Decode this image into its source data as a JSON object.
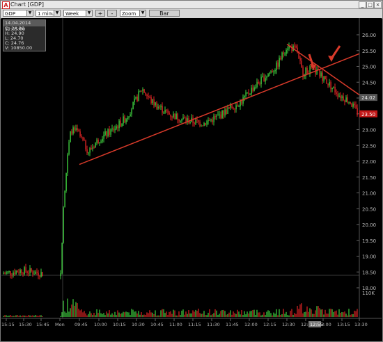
{
  "window": {
    "title": "Chart [GDP]",
    "app_icon": "A",
    "controls": [
      "_",
      "□",
      "×"
    ]
  },
  "toolbar": {
    "symbol": "GDP",
    "interval": "1 minute",
    "range": "Week",
    "plus_label": "+",
    "minus_label": "-",
    "zoom": "Zoom",
    "bar_label": "Bar"
  },
  "info_box": {
    "header": "14.04.2014 12:55:00",
    "open": "O: 24.86",
    "high": "H: 24.90",
    "low": "L: 24.70",
    "close": "C: 24.76",
    "volume": "V: 10850.00"
  },
  "price_axis": {
    "ticks": [
      "26.00",
      "25.50",
      "25.00",
      "24.50",
      "24.00",
      "23.50",
      "23.00",
      "22.50",
      "22.00",
      "21.50",
      "21.00",
      "20.50",
      "20.00",
      "19.50",
      "19.00",
      "18.50",
      "18.00"
    ],
    "current_price_label": "24.02",
    "last_price_label": "23.50",
    "volume_label": "110K"
  },
  "time_axis": {
    "ticks": [
      "15:15",
      "15:30",
      "15:45",
      "Mon",
      "09:45",
      "10:00",
      "10:15",
      "10:30",
      "10:45",
      "11:00",
      "11:15",
      "11:30",
      "11:45",
      "12:00",
      "12:15",
      "12:30",
      "12:45",
      "13:00",
      "13:15",
      "13:30"
    ],
    "cursor_label": "12:55"
  },
  "chart_data": {
    "type": "candlestick",
    "title": "GDP",
    "x_range": [
      "Fri 15:15",
      "Mon 13:30"
    ],
    "ylim": [
      17.8,
      26.3
    ],
    "series_summary": {
      "prior_session_price": 18.45,
      "open_after_gap": 20.4,
      "early_high": 23.0,
      "mid_high_1030": 24.3,
      "session_high_1235": 25.65,
      "last": 23.5
    },
    "trendlines": [
      {
        "name": "support-trendline",
        "from": [
          "09:45",
          21.9
        ],
        "to": [
          "13:30",
          25.4
        ]
      },
      {
        "name": "breakdown-trendline",
        "from": [
          "12:30",
          25.7
        ],
        "to": [
          "13:30",
          24.1
        ]
      }
    ],
    "annotations": [
      "arrow near 12:45",
      "arrow near 13:00"
    ],
    "colors": {
      "up": "#3fd13f",
      "down": "#e02424",
      "trendline": "#d83a2a",
      "background": "#000000"
    }
  }
}
